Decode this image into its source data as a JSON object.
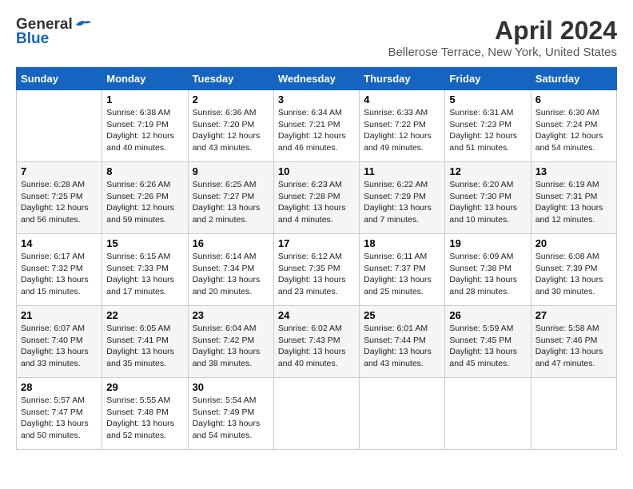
{
  "header": {
    "logo_general": "General",
    "logo_blue": "Blue",
    "title": "April 2024",
    "location": "Bellerose Terrace, New York, United States"
  },
  "columns": [
    "Sunday",
    "Monday",
    "Tuesday",
    "Wednesday",
    "Thursday",
    "Friday",
    "Saturday"
  ],
  "weeks": [
    [
      {
        "day": "",
        "info": ""
      },
      {
        "day": "1",
        "info": "Sunrise: 6:38 AM\nSunset: 7:19 PM\nDaylight: 12 hours\nand 40 minutes."
      },
      {
        "day": "2",
        "info": "Sunrise: 6:36 AM\nSunset: 7:20 PM\nDaylight: 12 hours\nand 43 minutes."
      },
      {
        "day": "3",
        "info": "Sunrise: 6:34 AM\nSunset: 7:21 PM\nDaylight: 12 hours\nand 46 minutes."
      },
      {
        "day": "4",
        "info": "Sunrise: 6:33 AM\nSunset: 7:22 PM\nDaylight: 12 hours\nand 49 minutes."
      },
      {
        "day": "5",
        "info": "Sunrise: 6:31 AM\nSunset: 7:23 PM\nDaylight: 12 hours\nand 51 minutes."
      },
      {
        "day": "6",
        "info": "Sunrise: 6:30 AM\nSunset: 7:24 PM\nDaylight: 12 hours\nand 54 minutes."
      }
    ],
    [
      {
        "day": "7",
        "info": "Sunrise: 6:28 AM\nSunset: 7:25 PM\nDaylight: 12 hours\nand 56 minutes."
      },
      {
        "day": "8",
        "info": "Sunrise: 6:26 AM\nSunset: 7:26 PM\nDaylight: 12 hours\nand 59 minutes."
      },
      {
        "day": "9",
        "info": "Sunrise: 6:25 AM\nSunset: 7:27 PM\nDaylight: 13 hours\nand 2 minutes."
      },
      {
        "day": "10",
        "info": "Sunrise: 6:23 AM\nSunset: 7:28 PM\nDaylight: 13 hours\nand 4 minutes."
      },
      {
        "day": "11",
        "info": "Sunrise: 6:22 AM\nSunset: 7:29 PM\nDaylight: 13 hours\nand 7 minutes."
      },
      {
        "day": "12",
        "info": "Sunrise: 6:20 AM\nSunset: 7:30 PM\nDaylight: 13 hours\nand 10 minutes."
      },
      {
        "day": "13",
        "info": "Sunrise: 6:19 AM\nSunset: 7:31 PM\nDaylight: 13 hours\nand 12 minutes."
      }
    ],
    [
      {
        "day": "14",
        "info": "Sunrise: 6:17 AM\nSunset: 7:32 PM\nDaylight: 13 hours\nand 15 minutes."
      },
      {
        "day": "15",
        "info": "Sunrise: 6:15 AM\nSunset: 7:33 PM\nDaylight: 13 hours\nand 17 minutes."
      },
      {
        "day": "16",
        "info": "Sunrise: 6:14 AM\nSunset: 7:34 PM\nDaylight: 13 hours\nand 20 minutes."
      },
      {
        "day": "17",
        "info": "Sunrise: 6:12 AM\nSunset: 7:35 PM\nDaylight: 13 hours\nand 23 minutes."
      },
      {
        "day": "18",
        "info": "Sunrise: 6:11 AM\nSunset: 7:37 PM\nDaylight: 13 hours\nand 25 minutes."
      },
      {
        "day": "19",
        "info": "Sunrise: 6:09 AM\nSunset: 7:38 PM\nDaylight: 13 hours\nand 28 minutes."
      },
      {
        "day": "20",
        "info": "Sunrise: 6:08 AM\nSunset: 7:39 PM\nDaylight: 13 hours\nand 30 minutes."
      }
    ],
    [
      {
        "day": "21",
        "info": "Sunrise: 6:07 AM\nSunset: 7:40 PM\nDaylight: 13 hours\nand 33 minutes."
      },
      {
        "day": "22",
        "info": "Sunrise: 6:05 AM\nSunset: 7:41 PM\nDaylight: 13 hours\nand 35 minutes."
      },
      {
        "day": "23",
        "info": "Sunrise: 6:04 AM\nSunset: 7:42 PM\nDaylight: 13 hours\nand 38 minutes."
      },
      {
        "day": "24",
        "info": "Sunrise: 6:02 AM\nSunset: 7:43 PM\nDaylight: 13 hours\nand 40 minutes."
      },
      {
        "day": "25",
        "info": "Sunrise: 6:01 AM\nSunset: 7:44 PM\nDaylight: 13 hours\nand 43 minutes."
      },
      {
        "day": "26",
        "info": "Sunrise: 5:59 AM\nSunset: 7:45 PM\nDaylight: 13 hours\nand 45 minutes."
      },
      {
        "day": "27",
        "info": "Sunrise: 5:58 AM\nSunset: 7:46 PM\nDaylight: 13 hours\nand 47 minutes."
      }
    ],
    [
      {
        "day": "28",
        "info": "Sunrise: 5:57 AM\nSunset: 7:47 PM\nDaylight: 13 hours\nand 50 minutes."
      },
      {
        "day": "29",
        "info": "Sunrise: 5:55 AM\nSunset: 7:48 PM\nDaylight: 13 hours\nand 52 minutes."
      },
      {
        "day": "30",
        "info": "Sunrise: 5:54 AM\nSunset: 7:49 PM\nDaylight: 13 hours\nand 54 minutes."
      },
      {
        "day": "",
        "info": ""
      },
      {
        "day": "",
        "info": ""
      },
      {
        "day": "",
        "info": ""
      },
      {
        "day": "",
        "info": ""
      }
    ]
  ]
}
